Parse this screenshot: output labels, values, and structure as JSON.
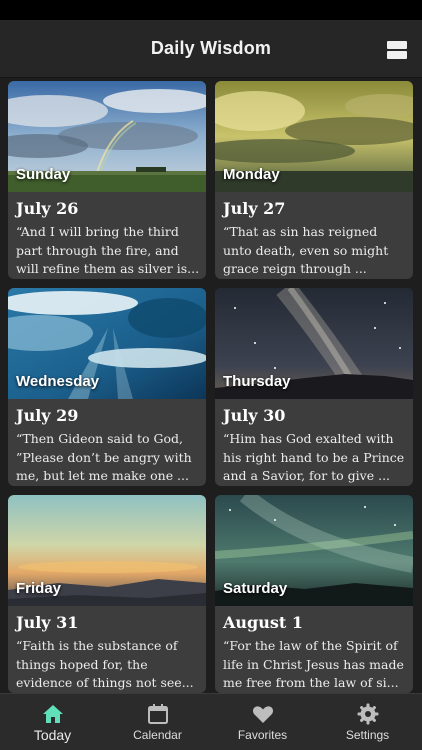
{
  "header": {
    "title": "Daily Wisdom",
    "menu_icon": "list-icon"
  },
  "cards": [
    {
      "day": "Sunday",
      "date": "July 26",
      "excerpt": "“And I will bring the third part through the fire, and will refine them as silver is..."
    },
    {
      "day": "Monday",
      "date": "July 27",
      "excerpt": "“That as sin has reigned unto death, even so might grace reign through ..."
    },
    {
      "day": "Wednesday",
      "date": "July 29",
      "excerpt": "“Then Gideon said to God, ”Please don’t be angry with me, but let me make one ..."
    },
    {
      "day": "Thursday",
      "date": "July 30",
      "excerpt": "“Him has God exalted with his right hand to be a Prince and a Savior, for to give ..."
    },
    {
      "day": "Friday",
      "date": "July 31",
      "excerpt": "“Faith is the substance of things hoped for, the evidence of things not see..."
    },
    {
      "day": "Saturday",
      "date": "August 1",
      "excerpt": "“For the law of the Spirit of life in Christ Jesus has made me free from the law of si..."
    }
  ],
  "tabs": [
    {
      "label": "Today",
      "icon": "home-icon",
      "active": true
    },
    {
      "label": "Calendar",
      "icon": "calendar-icon",
      "active": false
    },
    {
      "label": "Favorites",
      "icon": "heart-icon",
      "active": false
    },
    {
      "label": "Settings",
      "icon": "gear-icon",
      "active": false
    }
  ],
  "colors": {
    "accent": "#5fe0b8",
    "background": "#1e1e1e",
    "card": "#3d3d3d",
    "bar": "#2b2b2b"
  }
}
